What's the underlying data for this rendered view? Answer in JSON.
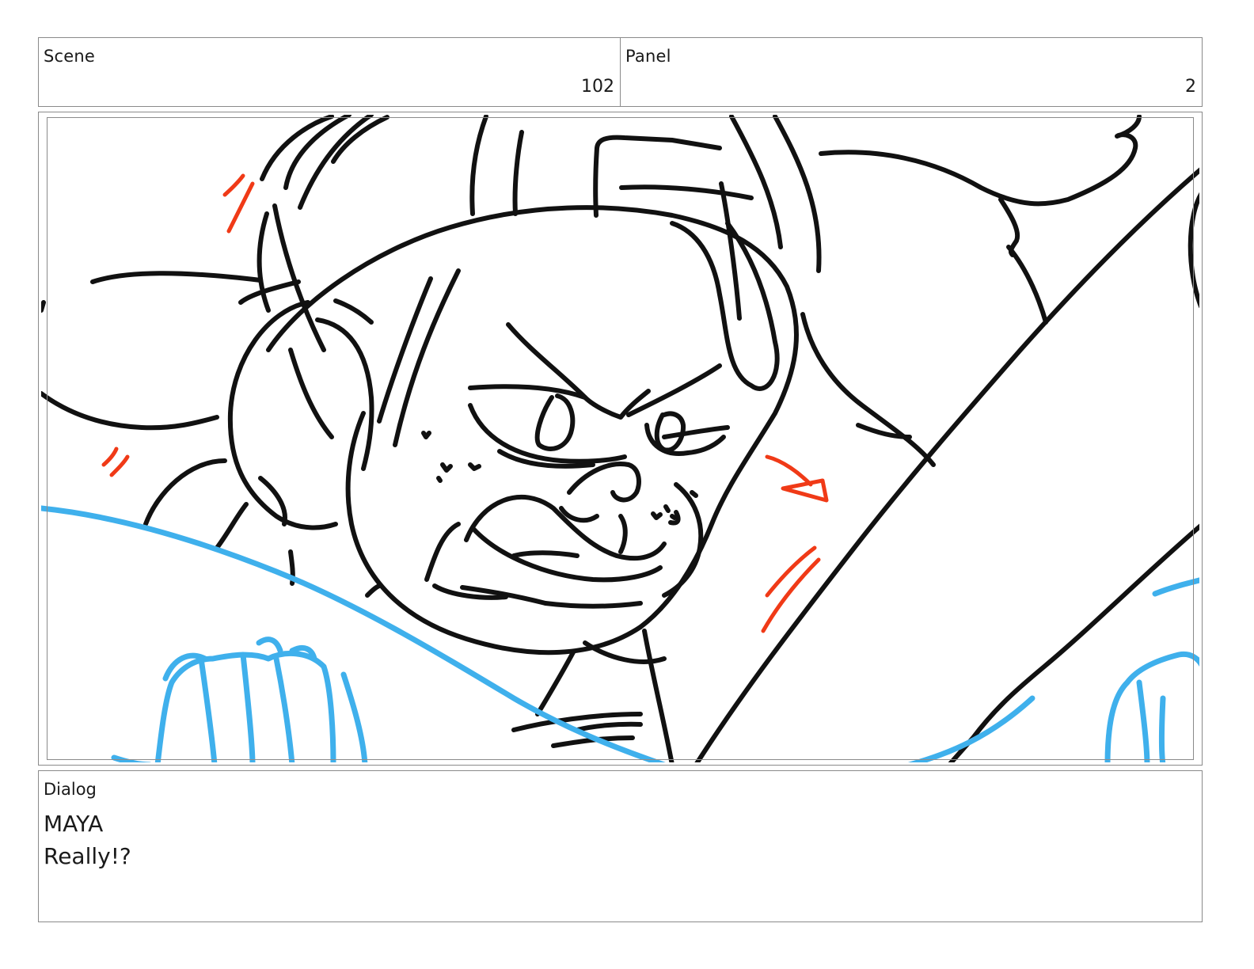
{
  "header": {
    "scene_label": "Scene",
    "scene_value": "102",
    "panel_label": "Panel",
    "panel_value": "2"
  },
  "frame": {
    "image_name": "storyboard-sketch",
    "colors": {
      "line": "#111111",
      "effect": "#f03a17",
      "foreground": "#3fb0ec"
    }
  },
  "dialog": {
    "label": "Dialog",
    "character": "MAYA",
    "text": "Really!?"
  }
}
